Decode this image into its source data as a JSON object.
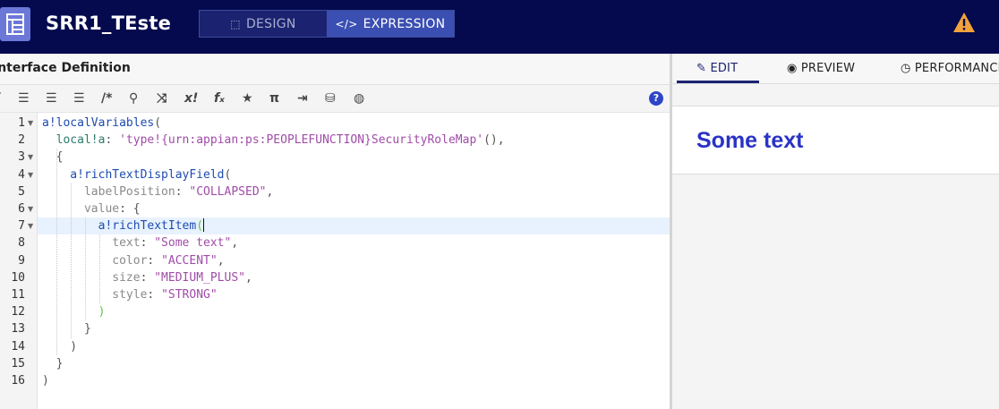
{
  "header": {
    "app_title": "SRR1_TEste",
    "design_label": "DESIGN",
    "expression_label": "EXPRESSION",
    "accent": "#050a4e",
    "warning_color": "#f1a33a"
  },
  "left": {
    "section_title": "Interface Definition",
    "toolbar_tools": [
      "format",
      "outdent",
      "indent",
      "list",
      "/*",
      "search",
      "shuffle",
      "x!",
      "fx",
      "star",
      "π",
      "export",
      "database",
      "globe",
      "help"
    ]
  },
  "code": {
    "line_numbers": [
      "1",
      "2",
      "3",
      "4",
      "5",
      "6",
      "7",
      "8",
      "9",
      "10",
      "11",
      "12",
      "13",
      "14",
      "15",
      "16"
    ],
    "lines": [
      [
        {
          "t": "a!localVariables",
          "c": "c-fn"
        },
        {
          "t": "(",
          "c": "c-pun"
        }
      ],
      [
        {
          "t": "  local!a",
          "c": "c-var"
        },
        {
          "t": ": ",
          "c": "c-pun"
        },
        {
          "t": "'type!{urn:appian:ps:PEOPLEFUNCTION}SecurityRoleMap'",
          "c": "c-str"
        },
        {
          "t": "(),",
          "c": "c-pun"
        }
      ],
      [
        {
          "t": "  {",
          "c": "c-pun"
        }
      ],
      [
        {
          "t": "    a!richTextDisplayField",
          "c": "c-fn"
        },
        {
          "t": "(",
          "c": "c-pun"
        }
      ],
      [
        {
          "t": "      labelPosition",
          "c": "c-prop"
        },
        {
          "t": ": ",
          "c": "c-pun"
        },
        {
          "t": "\"COLLAPSED\"",
          "c": "c-str"
        },
        {
          "t": ",",
          "c": "c-pun"
        }
      ],
      [
        {
          "t": "      value",
          "c": "c-prop"
        },
        {
          "t": ": {",
          "c": "c-pun"
        }
      ],
      [
        {
          "t": "        a!richTextItem",
          "c": "c-fn"
        },
        {
          "t": "(",
          "c": "c-bracket"
        }
      ],
      [
        {
          "t": "          text",
          "c": "c-prop"
        },
        {
          "t": ": ",
          "c": "c-pun"
        },
        {
          "t": "\"Some text\"",
          "c": "c-str"
        },
        {
          "t": ",",
          "c": "c-pun"
        }
      ],
      [
        {
          "t": "          color",
          "c": "c-prop"
        },
        {
          "t": ": ",
          "c": "c-pun"
        },
        {
          "t": "\"ACCENT\"",
          "c": "c-str"
        },
        {
          "t": ",",
          "c": "c-pun"
        }
      ],
      [
        {
          "t": "          size",
          "c": "c-prop"
        },
        {
          "t": ": ",
          "c": "c-pun"
        },
        {
          "t": "\"MEDIUM_PLUS\"",
          "c": "c-str"
        },
        {
          "t": ",",
          "c": "c-pun"
        }
      ],
      [
        {
          "t": "          style",
          "c": "c-prop"
        },
        {
          "t": ": ",
          "c": "c-pun"
        },
        {
          "t": "\"STRONG\"",
          "c": "c-str"
        }
      ],
      [
        {
          "t": "        )",
          "c": "c-bracket"
        }
      ],
      [
        {
          "t": "      }",
          "c": "c-pun"
        }
      ],
      [
        {
          "t": "    )",
          "c": "c-pun"
        }
      ],
      [
        {
          "t": "  }",
          "c": "c-pun"
        }
      ],
      [
        {
          "t": ")",
          "c": "c-pun"
        }
      ]
    ],
    "active_line": 7,
    "foldable_lines": [
      1,
      3,
      4,
      6,
      7
    ]
  },
  "right": {
    "tab_edit": "EDIT",
    "tab_preview": "PREVIEW",
    "tab_performance": "PERFORMANCE",
    "preview_text": "Some text",
    "preview_color": "#2a33c5"
  }
}
